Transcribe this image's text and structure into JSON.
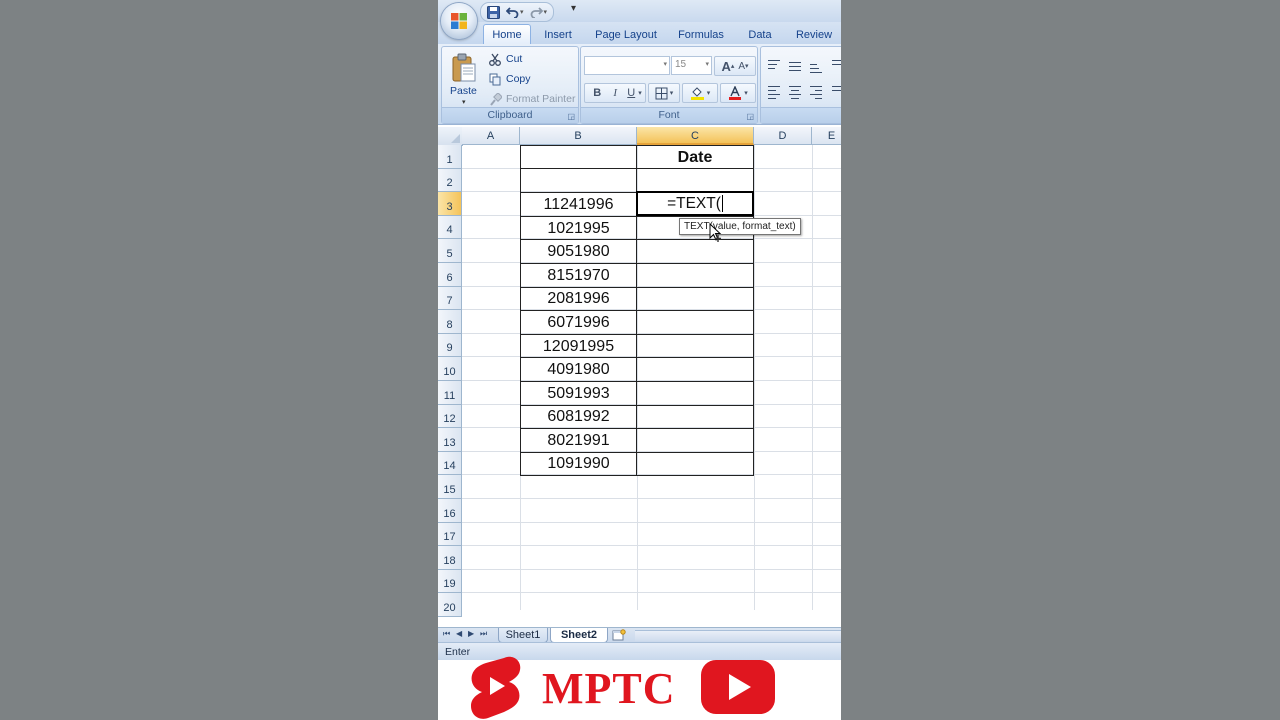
{
  "qat": {
    "save": "save-icon",
    "undo": "undo-icon",
    "redo": "redo-icon",
    "customize": "▾"
  },
  "ribbon": {
    "tabs": [
      "Home",
      "Insert",
      "Page Layout",
      "Formulas",
      "Data",
      "Review"
    ],
    "active_tab": "Home",
    "clipboard": {
      "paste": "Paste",
      "cut": "Cut",
      "copy": "Copy",
      "format_painter": "Format Painter",
      "label": "Clipboard"
    },
    "font": {
      "size": "15",
      "bold": "B",
      "italic": "I",
      "underline": "U",
      "grow": "A",
      "shrink": "A",
      "label": "Font"
    }
  },
  "sheet": {
    "columns": [
      "A",
      "B",
      "C",
      "D",
      "E"
    ],
    "rows": [
      "1",
      "2",
      "3",
      "4",
      "5",
      "6",
      "7",
      "8",
      "9",
      "10",
      "11",
      "12",
      "13",
      "14",
      "15",
      "16",
      "17",
      "18",
      "19",
      "20"
    ],
    "header_c1": "Date",
    "values_b": [
      "11241996",
      "1021995",
      "9051980",
      "8151970",
      "2081996",
      "6071996",
      "12091995",
      "4091980",
      "5091993",
      "6081992",
      "8021991",
      "1091990"
    ],
    "active_cell_text": "=TEXT(",
    "tooltip": "TEXT(value, format_text)",
    "selected_column": "C",
    "selected_row": "3"
  },
  "sheet_tabs": [
    "Sheet1",
    "Sheet2"
  ],
  "active_sheet": "Sheet2",
  "status": {
    "mode": "Enter"
  },
  "branding": {
    "channel": "MPTC"
  },
  "colors": {
    "brand_red": "#e0161f",
    "ribbon_text": "#15428b"
  }
}
